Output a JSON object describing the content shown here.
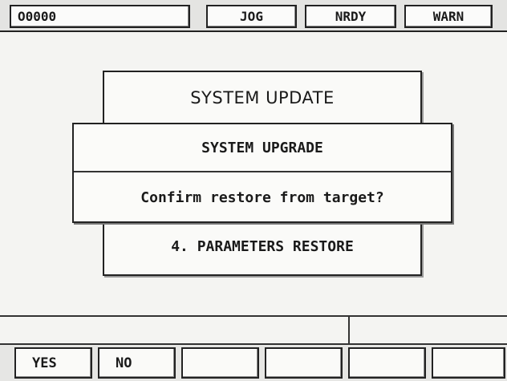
{
  "status_bar": {
    "program": "O0000",
    "mode": "JOG",
    "state": "NRDY",
    "alarm": "WARN"
  },
  "dialogs": {
    "system_update_title": "SYSTEM UPDATE",
    "upgrade_title": "SYSTEM UPGRADE",
    "confirm_message": "Confirm restore from target?",
    "selected_item": "4. PARAMETERS RESTORE"
  },
  "softkeys": [
    "YES",
    "NO",
    "",
    "",
    "",
    ""
  ]
}
